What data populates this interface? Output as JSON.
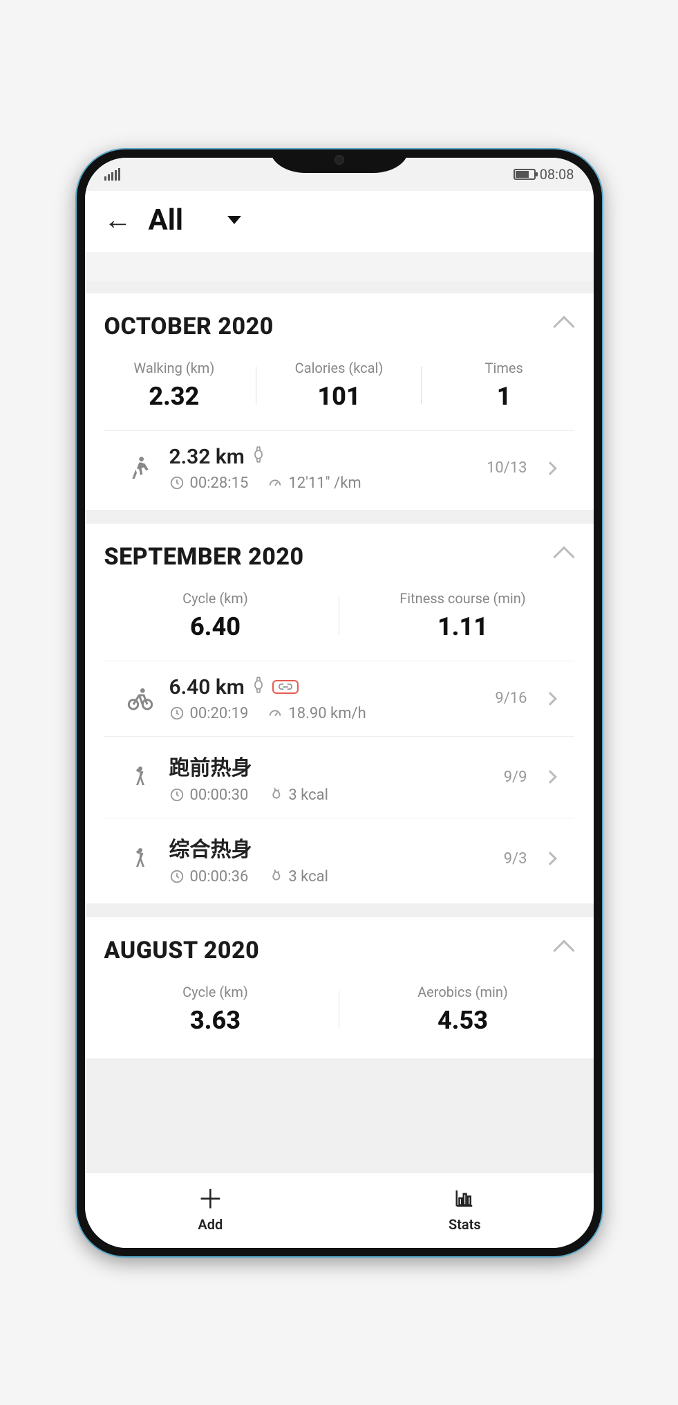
{
  "status": {
    "time": "08:08"
  },
  "header": {
    "title": "All"
  },
  "months": [
    {
      "title": "OCTOBER 2020",
      "summary": [
        {
          "label": "Walking (km)",
          "value": "2.32"
        },
        {
          "label": "Calories (kcal)",
          "value": "101"
        },
        {
          "label": "Times",
          "value": "1"
        }
      ],
      "activities": [
        {
          "type": "walk",
          "title": "2.32 km",
          "watch": true,
          "link": false,
          "duration": "00:28:15",
          "metric2_icon": "gauge",
          "metric2": "12'11\" /km",
          "date": "10/13"
        }
      ]
    },
    {
      "title": "SEPTEMBER 2020",
      "summary": [
        {
          "label": "Cycle (km)",
          "value": "6.40"
        },
        {
          "label": "Fitness course (min)",
          "value": "1.11"
        }
      ],
      "activities": [
        {
          "type": "cycle",
          "title": "6.40 km",
          "watch": true,
          "link": true,
          "duration": "00:20:19",
          "metric2_icon": "gauge",
          "metric2": "18.90 km/h",
          "date": "9/16"
        },
        {
          "type": "stretch",
          "title": "跑前热身",
          "watch": false,
          "link": false,
          "duration": "00:00:30",
          "metric2_icon": "flame",
          "metric2": "3 kcal",
          "date": "9/9"
        },
        {
          "type": "stretch",
          "title": "综合热身",
          "watch": false,
          "link": false,
          "duration": "00:00:36",
          "metric2_icon": "flame",
          "metric2": "3 kcal",
          "date": "9/3"
        }
      ]
    },
    {
      "title": "AUGUST 2020",
      "summary": [
        {
          "label": "Cycle (km)",
          "value": "3.63"
        },
        {
          "label": "Aerobics (min)",
          "value": "4.53"
        }
      ],
      "activities": []
    }
  ],
  "nav": {
    "add": "Add",
    "stats": "Stats"
  }
}
